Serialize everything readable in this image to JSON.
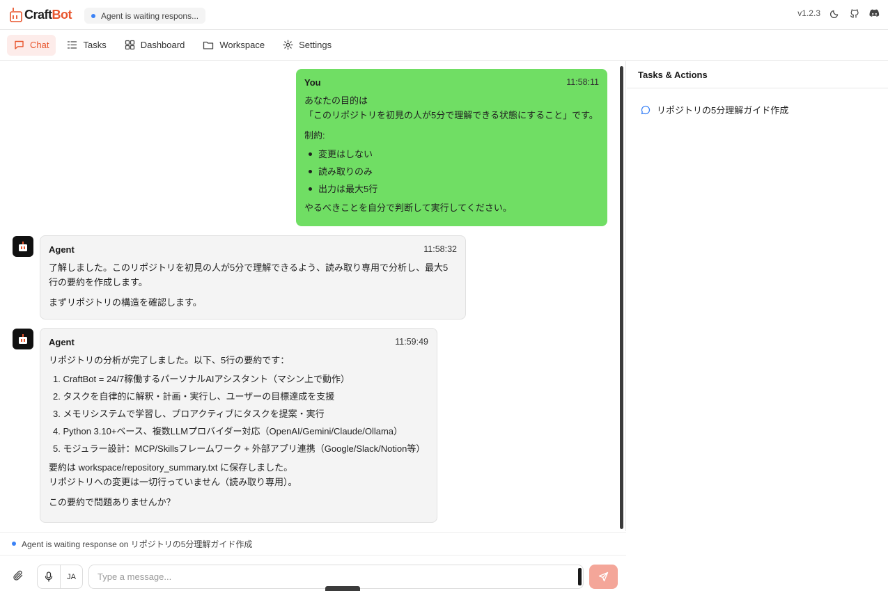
{
  "app": {
    "brand_part1": "Craft",
    "brand_part2": "Bot",
    "status_pill": "Agent is waiting respons...",
    "version": "v1.2.3"
  },
  "nav": {
    "tabs": [
      {
        "label": "Chat",
        "icon": "chat-icon",
        "active": true
      },
      {
        "label": "Tasks",
        "icon": "tasks-icon",
        "active": false
      },
      {
        "label": "Dashboard",
        "icon": "dashboard-icon",
        "active": false
      },
      {
        "label": "Workspace",
        "icon": "folder-icon",
        "active": false
      },
      {
        "label": "Settings",
        "icon": "gear-icon",
        "active": false
      }
    ]
  },
  "messages": [
    {
      "sender": "You",
      "time": "11:58:11",
      "lines": [
        "あなたの目的は",
        "「このリポジトリを初見の人が5分で理解できる状態にすること」です。"
      ],
      "constraint_label": "制約:",
      "bullets": [
        "変更はしない",
        "読み取りのみ",
        "出力は最大5行"
      ],
      "closing": "やるべきことを自分で判断して実行してください。"
    },
    {
      "sender": "Agent",
      "time": "11:58:32",
      "lines": [
        "了解しました。このリポジトリを初見の人が5分で理解できるよう、読み取り専用で分析し、最大5",
        "行の要約を作成します。"
      ],
      "closing": "まずリポジトリの構造を確認します。"
    },
    {
      "sender": "Agent",
      "time": "11:59:49",
      "intro": "リポジトリの分析が完了しました。以下、5行の要約です：",
      "numbered": [
        "1. CraftBot = 24/7稼働するパーソナルAIアシスタント（マシン上で動作）",
        "2. タスクを自律的に解釈・計画・実行し、ユーザーの目標達成を支援",
        "3. メモリシステムで学習し、プロアクティブにタスクを提案・実行",
        "4. Python 3.10+ベース、複数LLMプロバイダー対応（OpenAI/Gemini/Claude/Ollama）",
        "5. モジュラー設計：MCP/Skillsフレームワーク + 外部アプリ連携（Google/Slack/Notion等）"
      ],
      "saved_1": "要約は workspace/repository_summary.txt に保存しました。",
      "saved_2": "リポジトリへの変更は一切行っていません（読み取り専用）。",
      "closing": "この要約で問題ありませんか？"
    }
  ],
  "status_line": "Agent is waiting response on リポジトリの5分理解ガイド作成",
  "input": {
    "placeholder": "Type a message...",
    "lang_label": "JA"
  },
  "panel": {
    "title": "Tasks & Actions",
    "tasks": [
      {
        "label": "リポジトリの5分理解ガイド作成",
        "icon": "chat-bubble-icon"
      }
    ]
  },
  "colors": {
    "accent": "#e8552d",
    "user_bubble": "#70de64",
    "send_button": "#f4a699",
    "status_dot": "#3b82f6"
  }
}
